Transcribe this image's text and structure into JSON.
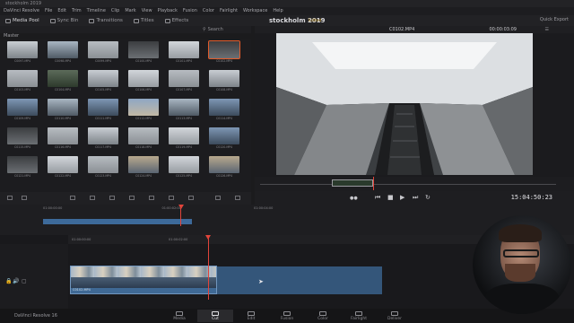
{
  "window": {
    "title": "stockholm 2019"
  },
  "menu": [
    "DaVinci Resolve",
    "File",
    "Edit",
    "Trim",
    "Timeline",
    "Clip",
    "Mark",
    "View",
    "Playback",
    "Fusion",
    "Color",
    "Fairlight",
    "Workspace",
    "Help"
  ],
  "toolbar": {
    "media_pool": "Media Pool",
    "sync_bin": "Sync Bin",
    "transitions": "Transitions",
    "titles": "Titles",
    "effects": "Effects",
    "project_title": "stockholm 2019",
    "project_status": "Edited",
    "quick_export": "Quick Export"
  },
  "media_pool": {
    "search_label": "Search",
    "bin": "Master",
    "selected_clip": "C0102.MP4",
    "clips": [
      "C0097.MP4",
      "C0098.MP4",
      "C0099.MP4",
      "C0100.MP4",
      "C0101.MP4",
      "C0102.MP4",
      "C0103.MP4",
      "C0104.MP4",
      "C0105.MP4",
      "C0106.MP4",
      "C0107.MP4",
      "C0108.MP4",
      "C0109.MP4",
      "C0110.MP4",
      "C0111.MP4",
      "C0112.MP4",
      "C0113.MP4",
      "C0114.MP4",
      "C0115.MP4",
      "C0116.MP4",
      "C0117.MP4",
      "C0118.MP4",
      "C0119.MP4",
      "C0120.MP4",
      "C0121.MP4",
      "C0122.MP4",
      "C0123.MP4",
      "C0124.MP4",
      "C0125.MP4",
      "C0126.MP4"
    ]
  },
  "viewer": {
    "clip_name": "C0102.MP4",
    "timecode_top": "00:00:03:09",
    "timecode": "15:04:50:23"
  },
  "timeline": {
    "upper_ruler": [
      "01:00:00:00",
      "01:00:02:00",
      "01:00:04:00"
    ],
    "lower_ruler": [
      "01:00:00:00",
      "01:00:02:00"
    ],
    "clip_label": "C0102.MP4"
  },
  "pages": [
    "Media",
    "Cut",
    "Edit",
    "Fusion",
    "Color",
    "Fairlight",
    "Deliver"
  ],
  "active_page": "Cut",
  "brand": "DaVinci Resolve 16",
  "colors": {
    "accent": "#e2443a",
    "clip_blue": "#3f6995",
    "status": "#c9a23a"
  }
}
